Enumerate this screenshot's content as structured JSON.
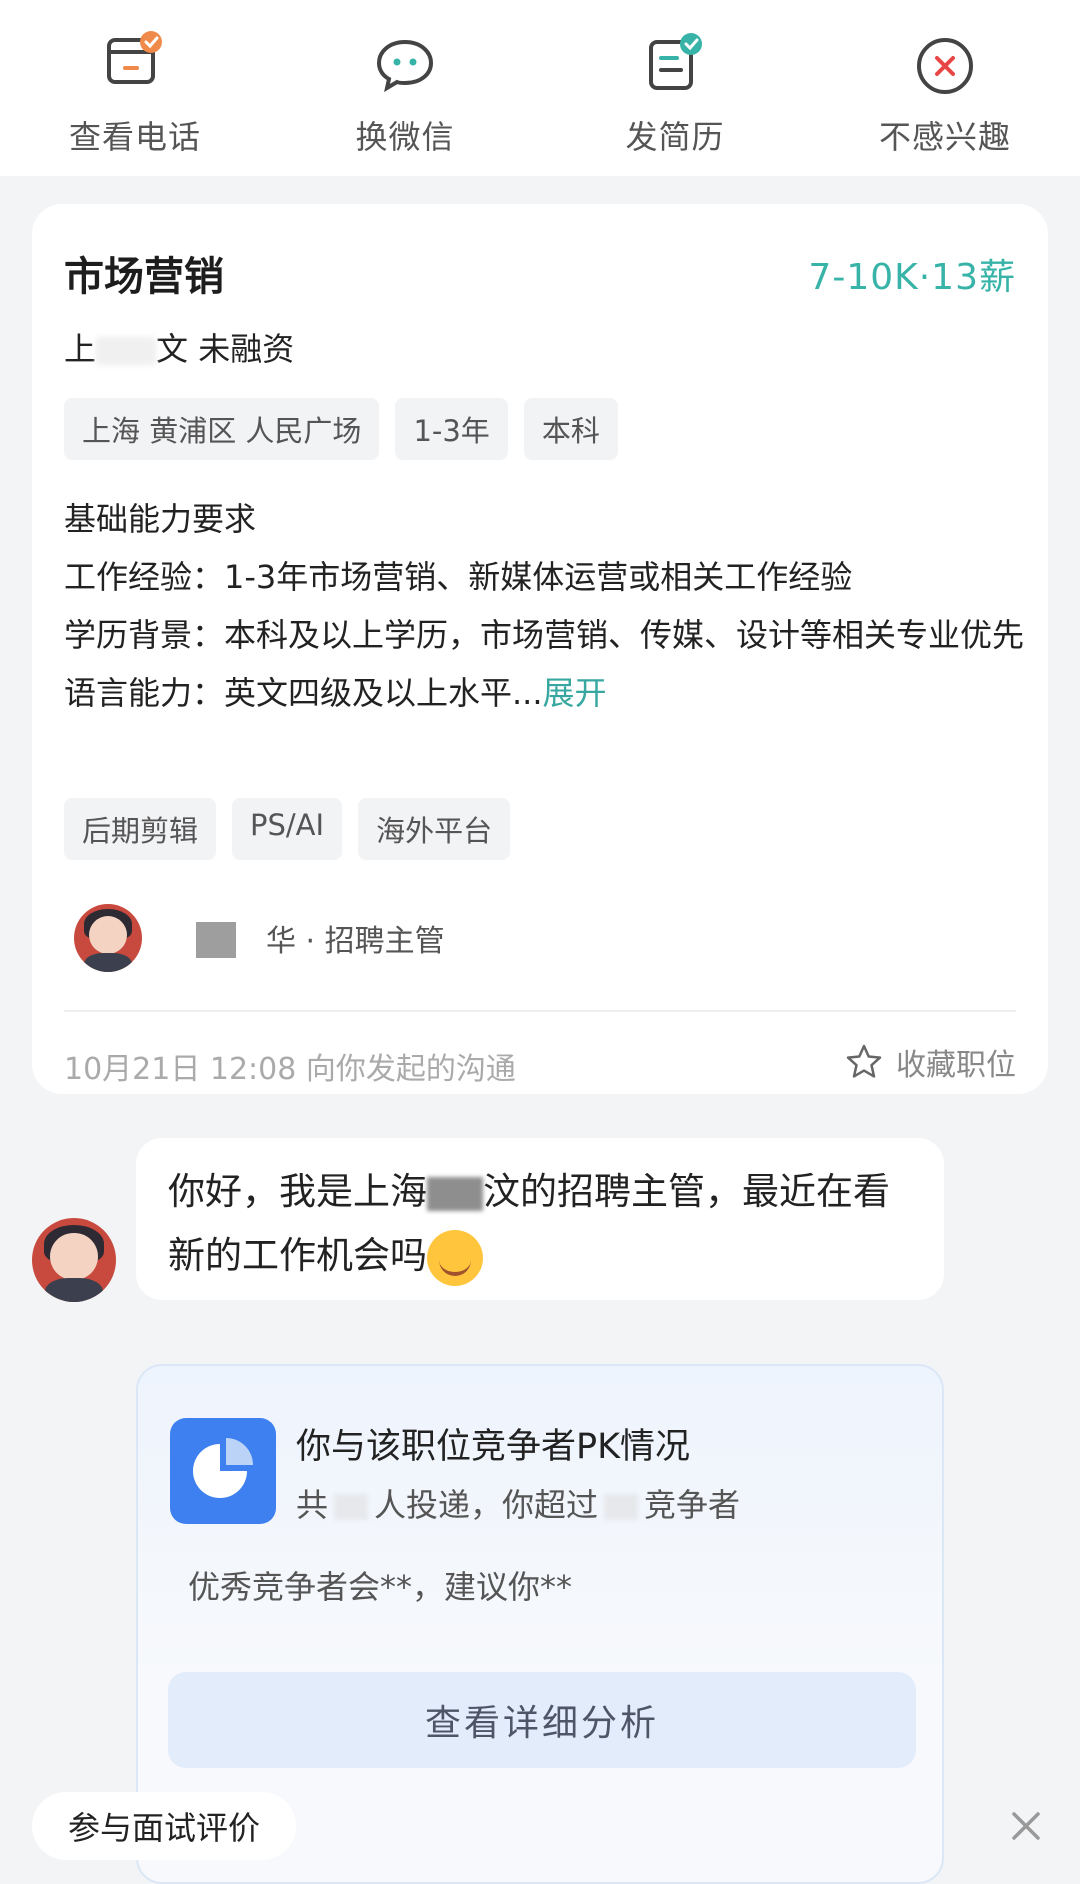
{
  "top_actions": [
    {
      "label": "查看电话",
      "icon": "phone-card-icon"
    },
    {
      "label": "换微信",
      "icon": "wechat-bubble-icon"
    },
    {
      "label": "发简历",
      "icon": "resume-icon"
    },
    {
      "label": "不感兴趣",
      "icon": "not-interested-icon"
    }
  ],
  "job": {
    "title": "市场营销",
    "salary": "7-10K·13薪",
    "company_prefix": "上",
    "company_suffix": "文 未融资",
    "tags": [
      "上海 黄浦区 人民广场",
      "1-3年",
      "本科"
    ],
    "requirements_heading": "基础能力要求",
    "requirement_lines": [
      "工作经验：1-3年市场营销、新媒体运营或相关工作经验",
      "学历背景：本科及以上学历，市场营销、传媒、设计等相关专业优先"
    ],
    "language_line": "语言能力：英文四级及以上水平...",
    "expand_label": "展开",
    "skill_tags": [
      "后期剪辑",
      "PS/AI",
      "海外平台"
    ],
    "recruiter_text": "华 · 招聘主管",
    "timestamp": "10月21日 12:08 向你发起的沟通",
    "collect_label": "收藏职位"
  },
  "message": {
    "part1": "你好，我是上海",
    "part2": "汶的招聘主管，最近在看新的工作机会吗"
  },
  "pk": {
    "title": "你与该职位竞争者PK情况",
    "sub_prefix": "共",
    "sub_middle": "人投递，你超过",
    "sub_suffix": "竞争者",
    "advice": "优秀竞争者会**，建议你**",
    "button_label": "查看详细分析"
  },
  "bottom": {
    "pill_label": "参与面试评价"
  },
  "colors": {
    "salary": "#37b3a8",
    "expand": "#37a7a0",
    "pk_icon": "#3e80ef"
  }
}
